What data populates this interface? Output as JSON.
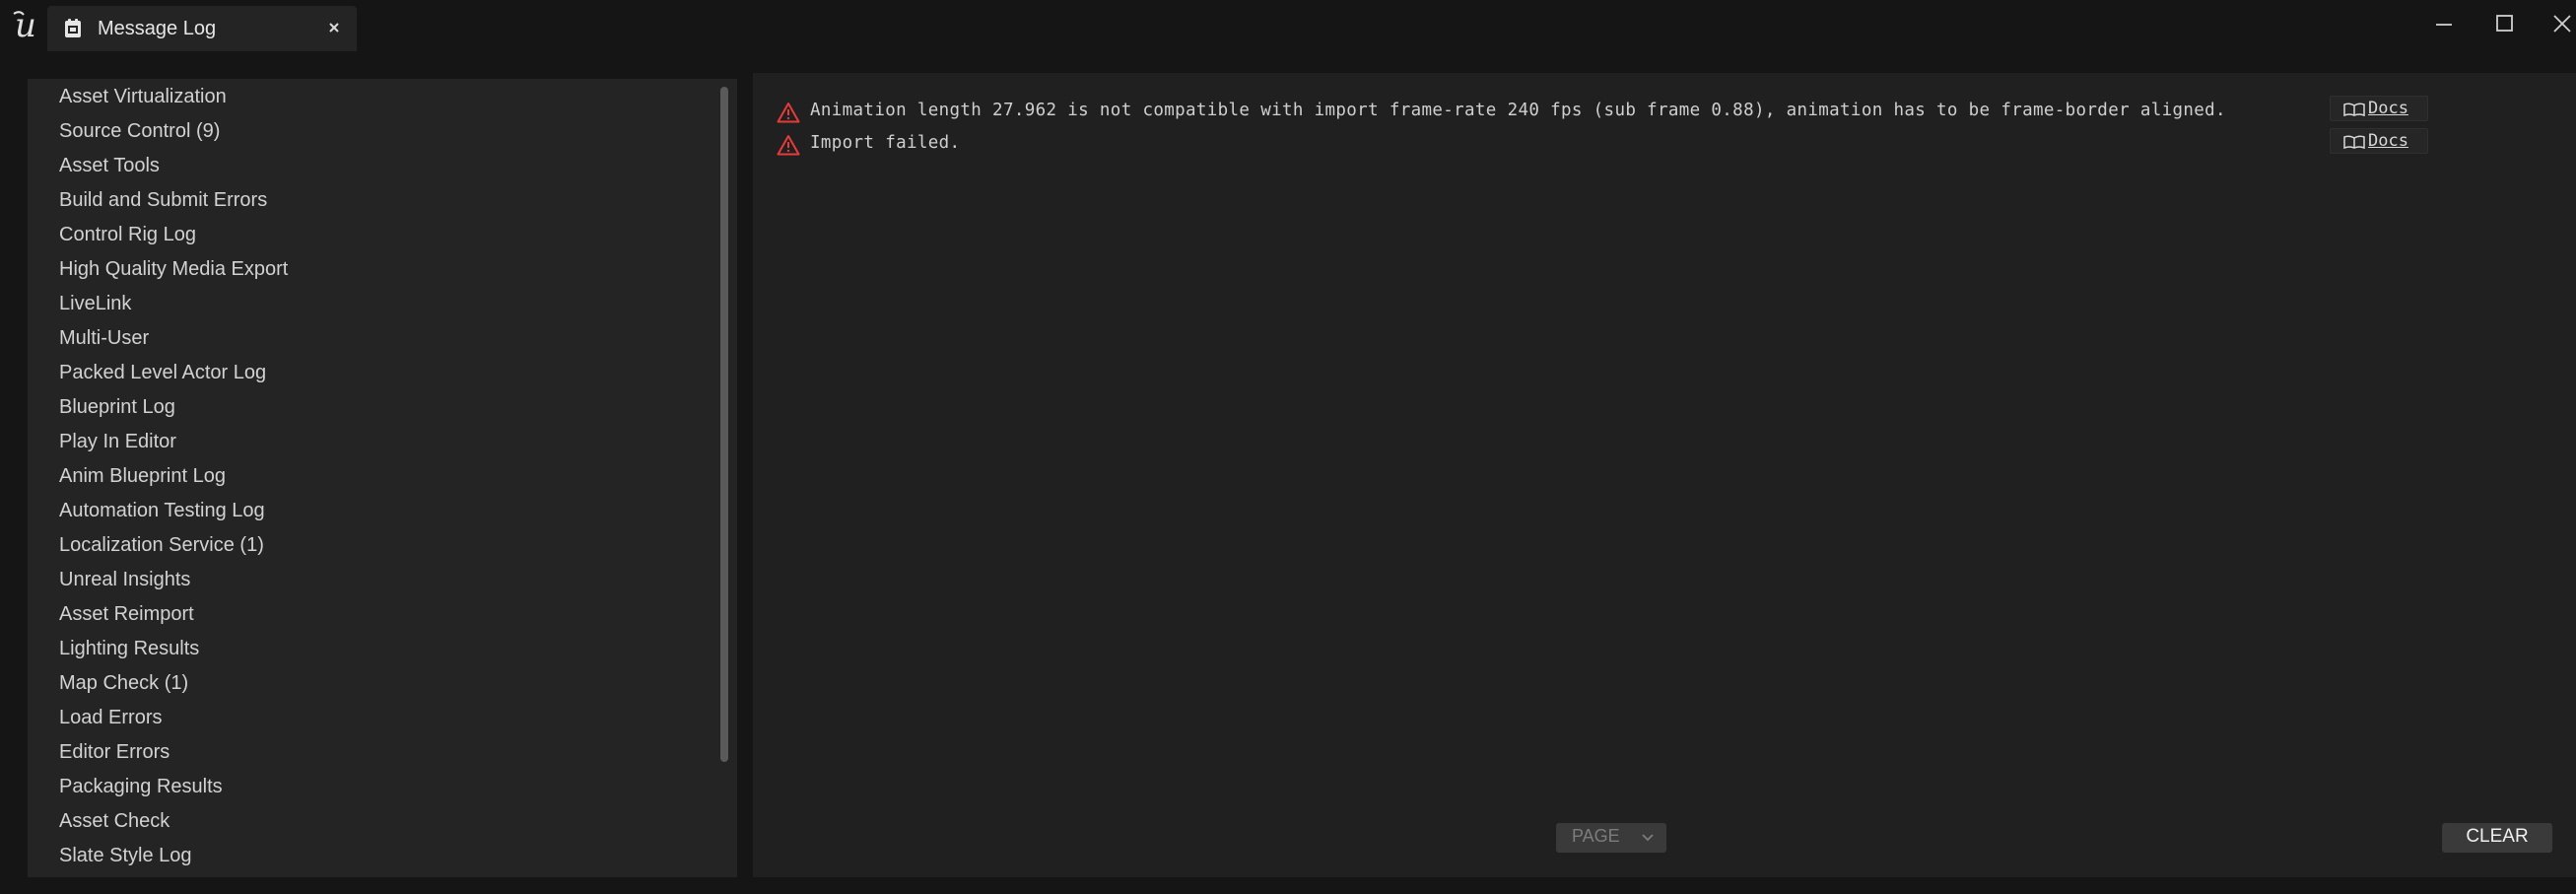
{
  "window": {
    "tab_title": "Message Log",
    "tab_icon": "message-log-icon",
    "logo": "unreal-engine-logo"
  },
  "categories": [
    "Asset Virtualization",
    "Source Control (9)",
    "Asset Tools",
    "Build and Submit Errors",
    "Control Rig Log",
    "High Quality Media Export",
    "LiveLink",
    "Multi-User",
    "Packed Level Actor Log",
    "Blueprint Log",
    "Play In Editor",
    "Anim Blueprint Log",
    "Automation Testing Log",
    "Localization Service (1)",
    "Unreal Insights",
    "Asset Reimport",
    "Lighting Results",
    "Map Check (1)",
    "Load Errors",
    "Editor Errors",
    "Packaging Results",
    "Asset Check",
    "Slate Style Log"
  ],
  "messages": [
    {
      "severity": "warning",
      "text": "Animation length 27.962 is not compatible with import frame-rate 240 fps (sub frame 0.88), animation has to be frame-border aligned.",
      "docs_label": "Docs"
    },
    {
      "severity": "warning",
      "text": "Import failed.",
      "docs_label": "Docs"
    }
  ],
  "footer": {
    "page_label": "PAGE",
    "clear_label": "CLEAR"
  },
  "colors": {
    "warning": "#e53b3b",
    "background": "#151515",
    "panel": "#242424"
  }
}
